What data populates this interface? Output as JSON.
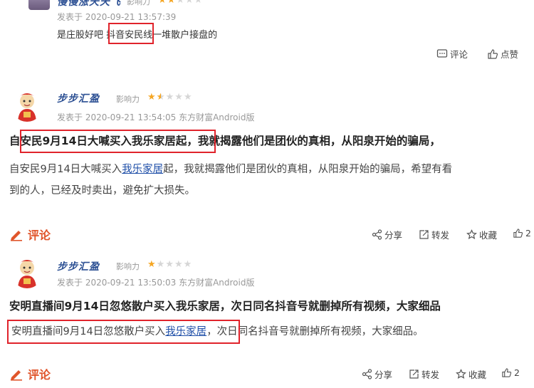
{
  "post1": {
    "author": "慢慢涨天天飞",
    "influence_label": "影响力",
    "rating": 2,
    "time": "发表于 2020-09-21 13:57:39",
    "text_before": "是庄股好吧 ",
    "text_highlight": "抖音安民",
    "text_after": "线一堆散户接盘的",
    "actions": {
      "comment": "评论",
      "like": "点赞"
    }
  },
  "post2": {
    "author": "步步汇盈",
    "influence_label": "影响力",
    "rating": 1.5,
    "time": "发表于 2020-09-21 13:54:05 东方财富Android版",
    "title_pre": "自",
    "title_highlight": "安民9月14日大喊买入我乐家居起",
    "title_post": "，我就揭露他们是团伙的真相，从阳泉开始的骗局，",
    "body_pre": "自安民9月14日大喊买入",
    "body_link": "我乐家居",
    "body_post": "起，我就揭露他们是团伙的真相，从阳泉开始的骗局，希望有看",
    "body_line2": "到的人，已经及时卖出，避免扩大损失。",
    "actions": {
      "comment": "评论",
      "share": "分享",
      "forward": "转发",
      "collect": "收藏",
      "like_count": "2"
    }
  },
  "post3": {
    "author": "步步汇盈",
    "influence_label": "影响力",
    "rating": 1,
    "time": "发表于 2020-09-21 13:50:03 东方财富Android版",
    "title": "安明直播间9月14日忽悠散户买入我乐家居，次日同名抖音号就删掉所有视频，大家细品",
    "body_pre": "安明直播间9月14日忽悠散户买入",
    "body_link": "我乐家居",
    "body_post": "，次日同名抖音号就删掉所有视频，大家细品。",
    "actions": {
      "comment": "评论",
      "share": "分享",
      "forward": "转发",
      "collect": "收藏",
      "like_count": "2"
    }
  }
}
